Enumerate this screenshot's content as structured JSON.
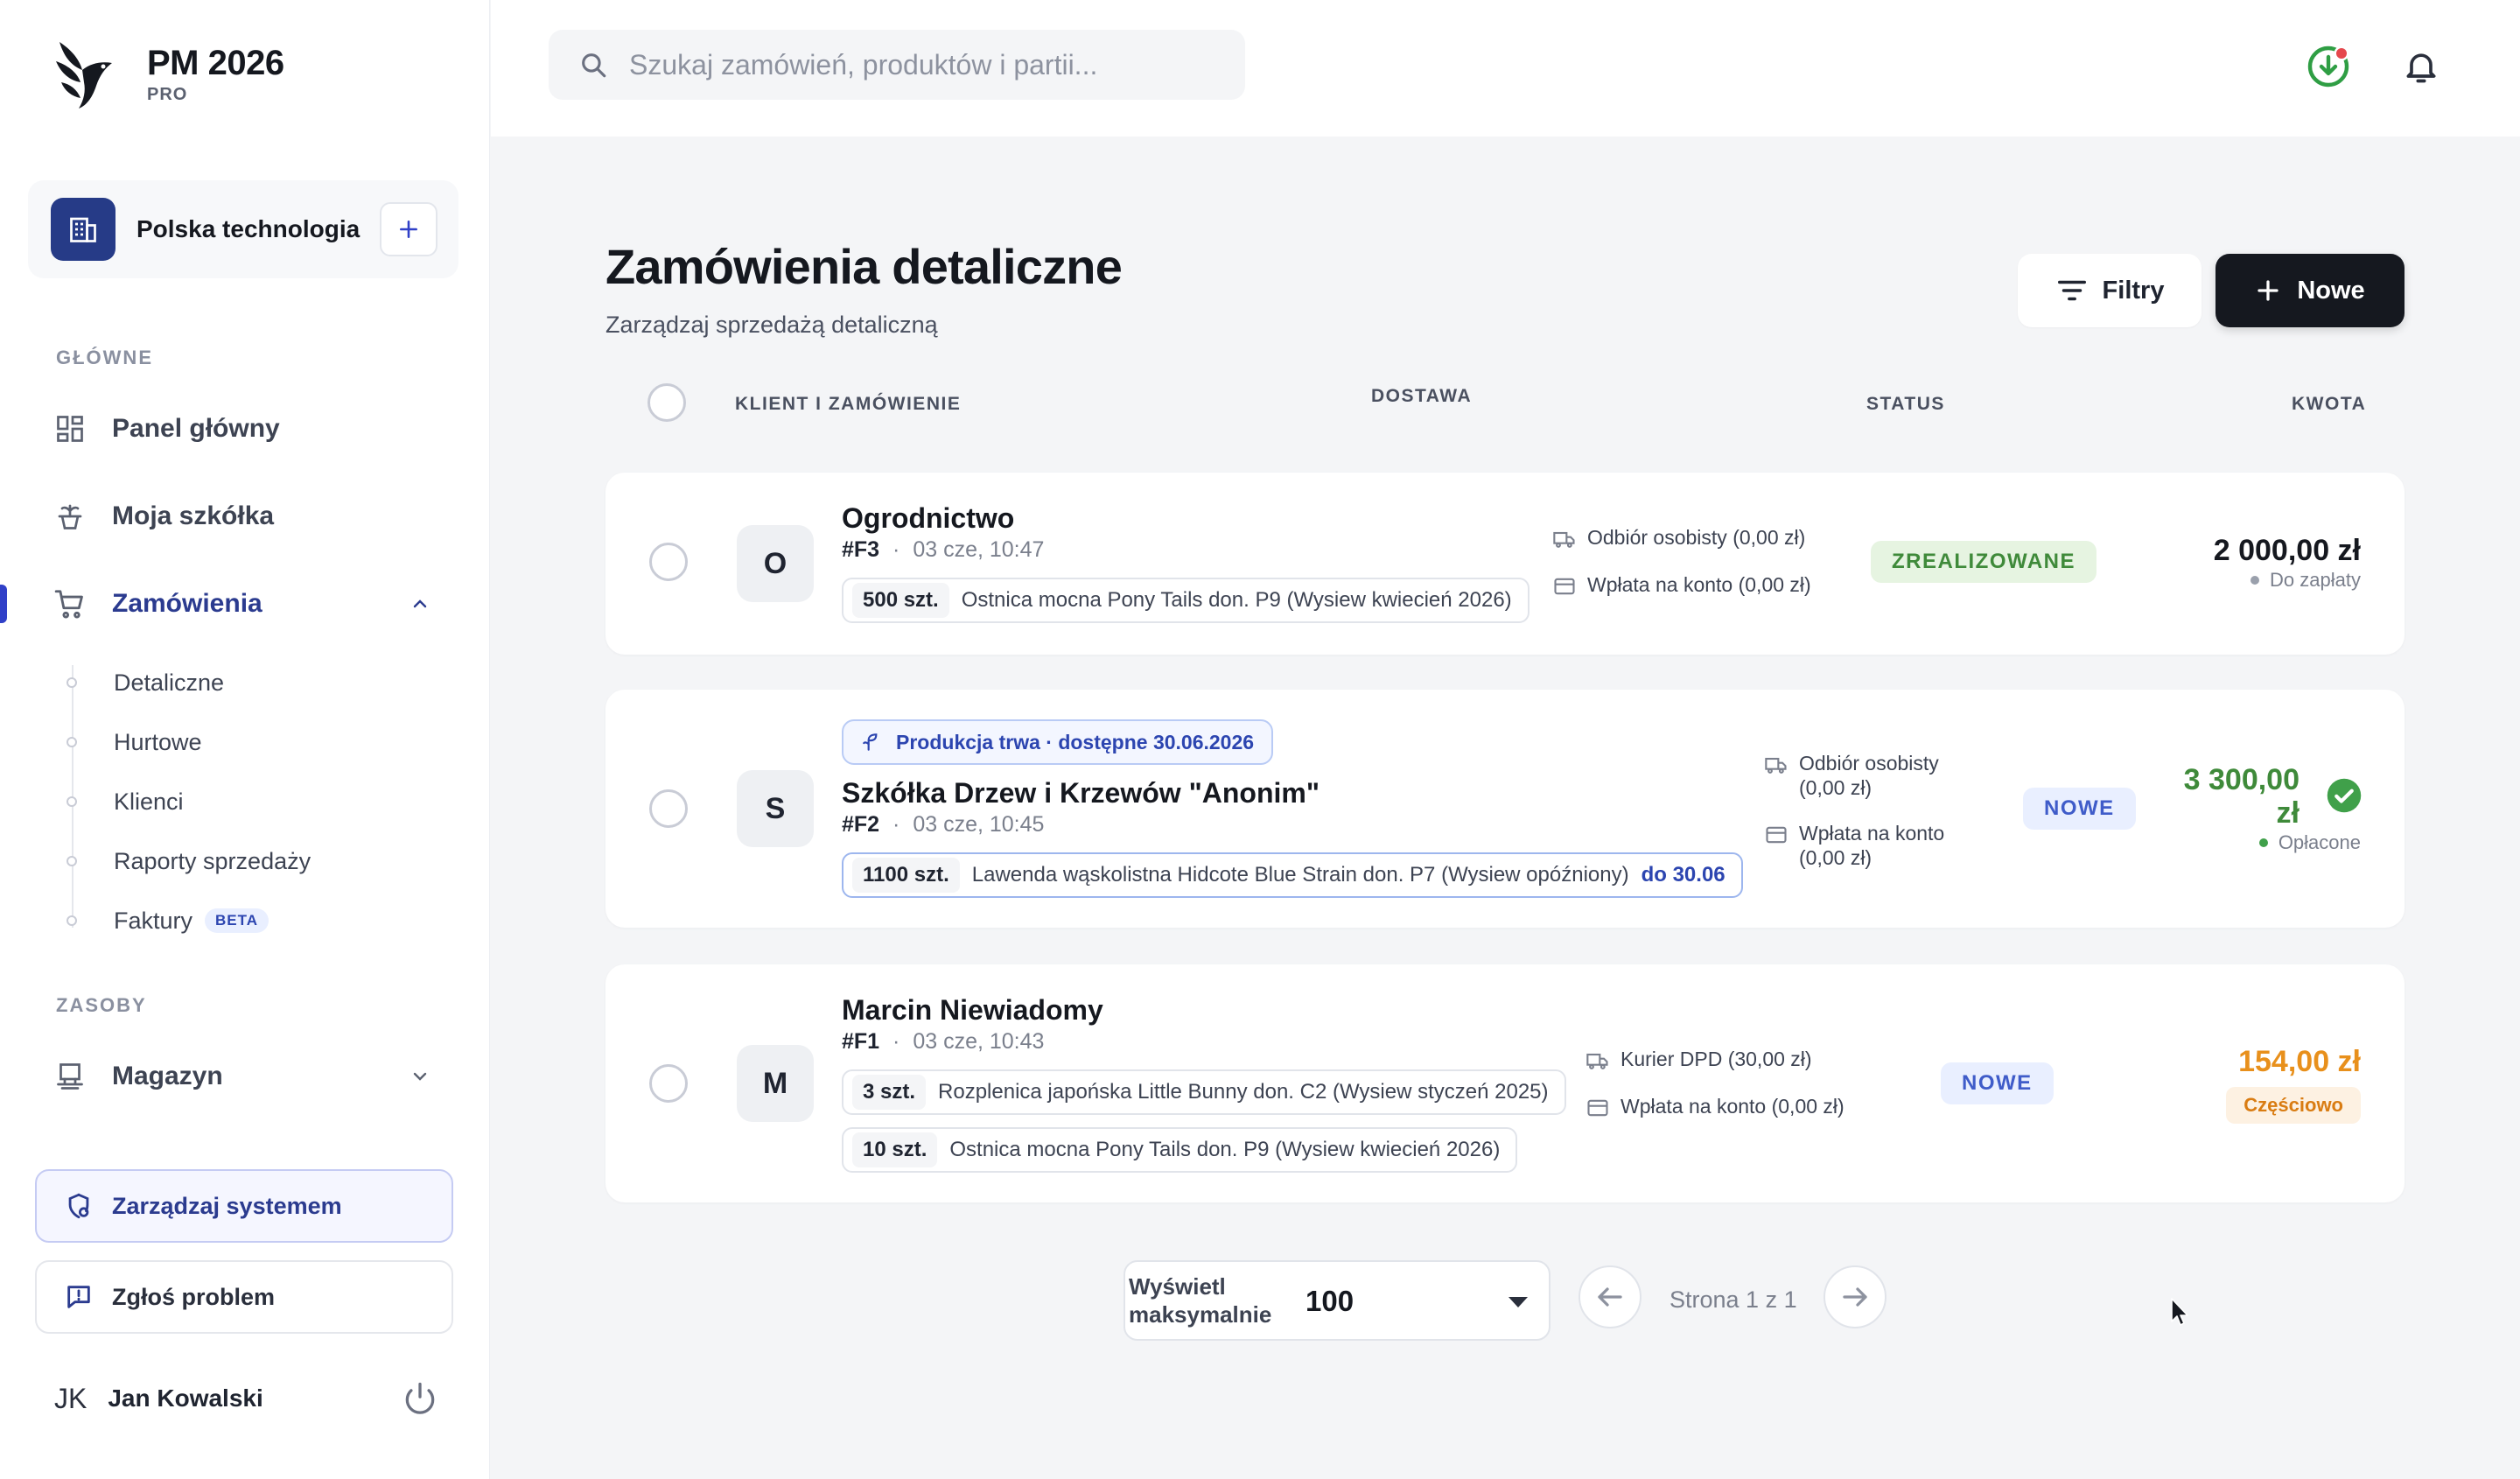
{
  "brand": {
    "title": "PM 2026",
    "tier": "PRO"
  },
  "organization": {
    "name": "Polska technologia"
  },
  "sidebar": {
    "section_main": "GŁÓWNE",
    "section_resources": "ZASOBY",
    "items": [
      {
        "label": "Panel główny",
        "icon": "dashboard-icon"
      },
      {
        "label": "Moja szkółka",
        "icon": "plant-pot-icon"
      },
      {
        "label": "Zamówienia",
        "icon": "cart-icon",
        "expanded": true,
        "active": true
      },
      {
        "label": "Magazyn",
        "icon": "warehouse-icon",
        "expanded": false
      }
    ],
    "orders_sub": [
      {
        "label": "Detaliczne"
      },
      {
        "label": "Hurtowe"
      },
      {
        "label": "Klienci"
      },
      {
        "label": "Raporty sprzedaży"
      },
      {
        "label": "Faktury",
        "badge": "BETA"
      }
    ],
    "manage_system": "Zarządzaj systemem",
    "report_problem": "Zgłoś problem"
  },
  "user": {
    "initials": "JK",
    "name": "Jan Kowalski"
  },
  "search": {
    "placeholder": "Szukaj zamówień, produktów i partii...",
    "value": ""
  },
  "page": {
    "title": "Zamówienia detaliczne",
    "subtitle": "Zarządzaj sprzedażą detaliczną",
    "filter_label": "Filtry",
    "new_label": "Nowe"
  },
  "table": {
    "headers": {
      "client": "KLIENT I ZAMÓWIENIE",
      "delivery": "DOSTAWA",
      "status": "STATUS",
      "amount": "KWOTA"
    }
  },
  "orders": [
    {
      "avatar": "O",
      "client": "Ogrodnictwo",
      "number": "#F3",
      "separator": "·",
      "date": "03 cze, 10:47",
      "items": [
        {
          "qty": "500 szt.",
          "name": "Ostnica mocna Pony Tails don. P9 (Wysiew kwiecień 2026)"
        }
      ],
      "delivery": "Odbiór osobisty (0,00 zł)",
      "payment": "Wpłata na konto (0,00 zł)",
      "status": "ZREALIZOWANE",
      "amount": "2 000,00 zł",
      "payment_state": "Do zapłaty",
      "amount_color": "#15181f"
    },
    {
      "avatar": "S",
      "production_note": "Produkcja trwa · dostępne 30.06.2026",
      "client": "Szkółka Drzew i Krzewów \"Anonim\"",
      "number": "#F2",
      "separator": "·",
      "date": "03 cze, 10:45",
      "items": [
        {
          "qty": "1100 szt.",
          "name": "Lawenda wąskolistna Hidcote Blue Strain don. P7 (Wysiew opóźniony)",
          "due": "do 30.06"
        }
      ],
      "delivery_line1": "Odbiór osobisty",
      "delivery_line2": "(0,00 zł)",
      "payment_line1": "Wpłata na konto",
      "payment_line2": "(0,00 zł)",
      "status": "NOWE",
      "amount_line1": "3 300,00",
      "amount_line2": "zł",
      "payment_state": "Opłacone",
      "amount_color": "#3f8a3a"
    },
    {
      "avatar": "M",
      "client": "Marcin Niewiadomy",
      "number": "#F1",
      "separator": "·",
      "date": "03 cze, 10:43",
      "items": [
        {
          "qty": "3 szt.",
          "name": "Rozplenica japońska Little Bunny don. C2 (Wysiew styczeń 2025)"
        },
        {
          "qty": "10 szt.",
          "name": "Ostnica mocna Pony Tails don. P9 (Wysiew kwiecień 2026)"
        }
      ],
      "delivery": "Kurier DPD (30,00 zł)",
      "payment": "Wpłata na konto (0,00 zł)",
      "status": "NOWE",
      "amount": "154,00 zł",
      "payment_state": "Częściowo",
      "amount_color": "#e8901c"
    }
  ],
  "pagination": {
    "page_size_label": "Wyświetl maksymalnie",
    "page_size_value": "100",
    "page_text": "Strona 1 z 1"
  },
  "colors": {
    "accent": "#263b87",
    "dark_button": "#15181f",
    "done_green": "#3f8a3a",
    "new_blue": "#3f5cc9",
    "partial_orange": "#e8901c",
    "notify_red": "#e5484d"
  }
}
